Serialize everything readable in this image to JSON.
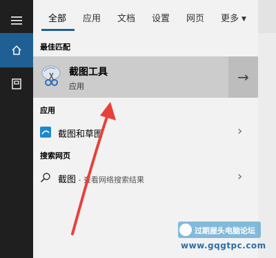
{
  "tabs": [
    {
      "label": "全部",
      "active": true
    },
    {
      "label": "应用"
    },
    {
      "label": "文档"
    },
    {
      "label": "设置"
    },
    {
      "label": "网页"
    },
    {
      "label": "更多"
    }
  ],
  "sections": {
    "best_match": "最佳匹配",
    "apps": "应用",
    "web": "搜索网页"
  },
  "best_match": {
    "title": "截图工具",
    "subtitle": "应用",
    "icon": "scissors-icon",
    "arrow": "→"
  },
  "apps": [
    {
      "label": "截图和草图",
      "icon": "snip-sketch-icon",
      "chevron": "›"
    }
  ],
  "web": [
    {
      "label": "截图",
      "suffix": " - 查看网络搜索结果",
      "icon": "search-icon",
      "chevron": "›"
    }
  ],
  "watermark": {
    "name": "过期屋头电脑论坛",
    "url": "www.gqgtpc.com"
  },
  "colors": {
    "rail": "#1f1f1f",
    "accent": "#1f5f94",
    "selected": "#cccccc",
    "annotation_arrow": "#e8403a"
  }
}
